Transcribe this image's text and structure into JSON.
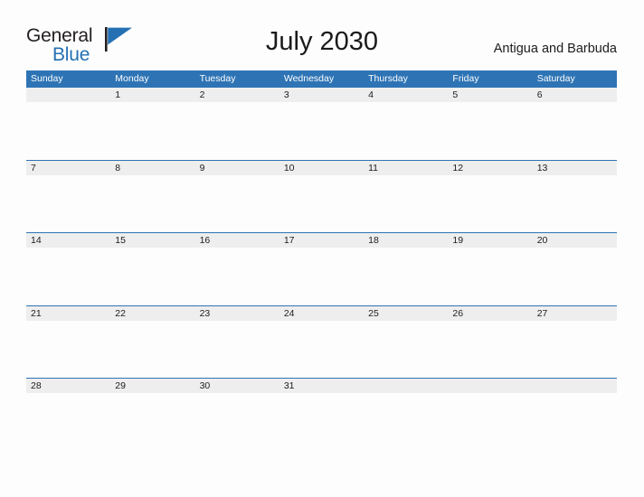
{
  "brand": {
    "line1": "General",
    "line2": "Blue",
    "flag_icon": "flag-triangle-icon",
    "color_dark": "#231f20",
    "color_blue": "#2470b3"
  },
  "header": {
    "title": "July 2030",
    "locale": "Antigua and Barbuda"
  },
  "calendar": {
    "accent_color": "#2e74b5",
    "band_color": "#eeeeee",
    "weekdays": [
      "Sunday",
      "Monday",
      "Tuesday",
      "Wednesday",
      "Thursday",
      "Friday",
      "Saturday"
    ],
    "weeks": [
      [
        "",
        "1",
        "2",
        "3",
        "4",
        "5",
        "6"
      ],
      [
        "7",
        "8",
        "9",
        "10",
        "11",
        "12",
        "13"
      ],
      [
        "14",
        "15",
        "16",
        "17",
        "18",
        "19",
        "20"
      ],
      [
        "21",
        "22",
        "23",
        "24",
        "25",
        "26",
        "27"
      ],
      [
        "28",
        "29",
        "30",
        "31",
        "",
        "",
        ""
      ]
    ]
  }
}
